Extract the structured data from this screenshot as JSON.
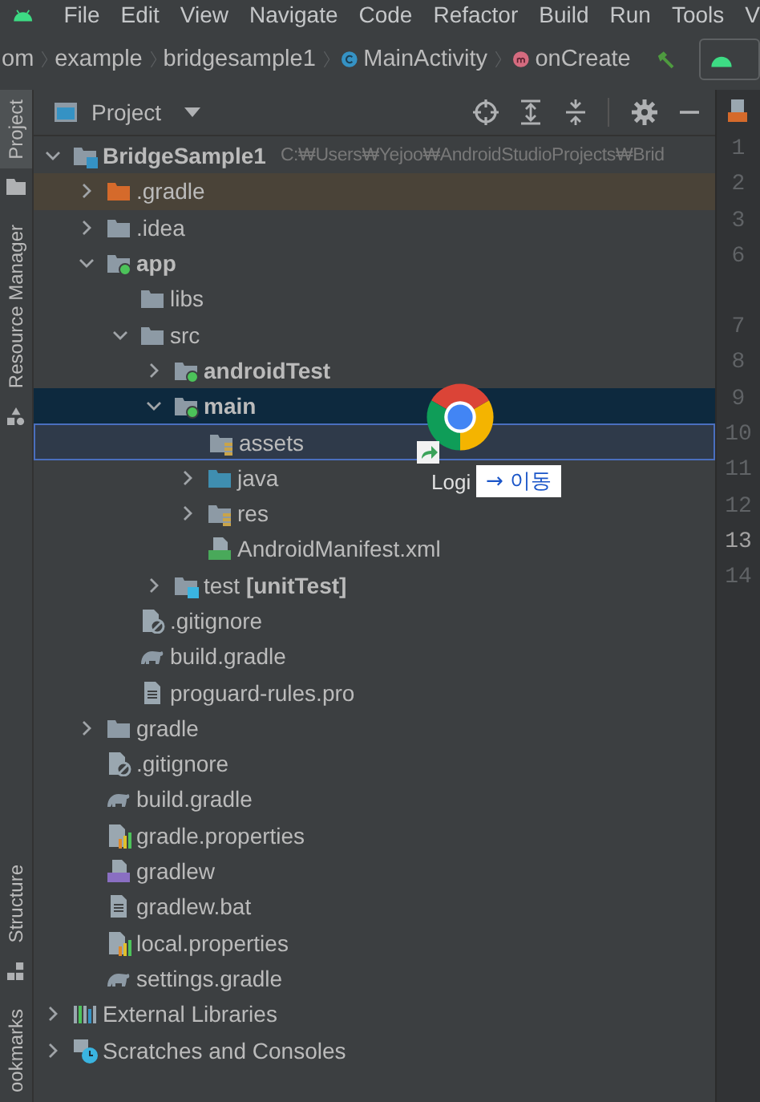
{
  "menu_bar": {
    "items": [
      "File",
      "Edit",
      "View",
      "Navigate",
      "Code",
      "Refactor",
      "Build",
      "Run",
      "Tools",
      "V"
    ]
  },
  "breadcrumbs": [
    {
      "label": "om",
      "kind": "package"
    },
    {
      "label": "example",
      "kind": "package"
    },
    {
      "label": "bridgesample1",
      "kind": "package"
    },
    {
      "label": "MainActivity",
      "kind": "class"
    },
    {
      "label": "onCreate",
      "kind": "method"
    }
  ],
  "side_tabs": {
    "top": [
      {
        "label": "Project",
        "selected": true
      },
      {
        "label": "Resource Manager",
        "selected": false
      }
    ],
    "bottom": [
      {
        "label": "Structure",
        "selected": false
      },
      {
        "label": "ookmarks",
        "selected": false
      }
    ]
  },
  "project_panel": {
    "title": "Project",
    "tree": [
      {
        "name": "BridgeSample1",
        "kind": "root",
        "hint": "C:₩Users₩Yejoo₩AndroidStudioProjects₩Brid",
        "expanded": true,
        "selected": false,
        "drop_target": false,
        "children": [
          {
            "name": ".gradle",
            "kind": "excluded-folder",
            "expanded": false,
            "selected": false,
            "drop_target": false
          },
          {
            "name": ".idea",
            "kind": "folder",
            "expanded": false,
            "selected": false,
            "drop_target": false
          },
          {
            "name": "app",
            "kind": "module",
            "expanded": true,
            "selected": false,
            "drop_target": false,
            "children": [
              {
                "name": "libs",
                "kind": "folder",
                "selected": false,
                "drop_target": false
              },
              {
                "name": "src",
                "kind": "folder",
                "expanded": true,
                "selected": false,
                "drop_target": false,
                "children": [
                  {
                    "name": "androidTest",
                    "kind": "module",
                    "expanded": false,
                    "selected": false,
                    "drop_target": false
                  },
                  {
                    "name": "main",
                    "kind": "module",
                    "expanded": true,
                    "selected": true,
                    "drop_target": false,
                    "children": [
                      {
                        "name": "assets",
                        "kind": "resource-folder",
                        "selected": false,
                        "drop_target": true
                      },
                      {
                        "name": "java",
                        "kind": "source-folder",
                        "expanded": false,
                        "selected": false,
                        "drop_target": false
                      },
                      {
                        "name": "res",
                        "kind": "resource-folder",
                        "expanded": false,
                        "selected": false,
                        "drop_target": false
                      },
                      {
                        "name": "AndroidManifest.xml",
                        "kind": "manifest",
                        "selected": false,
                        "drop_target": false
                      }
                    ]
                  },
                  {
                    "name": "test **[unitTest]**",
                    "kind": "test-folder",
                    "expanded": false,
                    "selected": false,
                    "drop_target": false
                  }
                ]
              },
              {
                "name": ".gitignore",
                "kind": "ignore-file",
                "selected": false,
                "drop_target": false
              },
              {
                "name": "build.gradle",
                "kind": "gradle",
                "selected": false,
                "drop_target": false
              },
              {
                "name": "proguard-rules.pro",
                "kind": "text-file",
                "selected": false,
                "drop_target": false
              }
            ]
          },
          {
            "name": "gradle",
            "kind": "folder",
            "expanded": false,
            "selected": false,
            "drop_target": false
          },
          {
            "name": ".gitignore",
            "kind": "ignore-file",
            "selected": false,
            "drop_target": false
          },
          {
            "name": "build.gradle",
            "kind": "gradle",
            "selected": false,
            "drop_target": false
          },
          {
            "name": "gradle.properties",
            "kind": "properties",
            "selected": false,
            "drop_target": false
          },
          {
            "name": "gradlew",
            "kind": "script",
            "selected": false,
            "drop_target": false
          },
          {
            "name": "gradlew.bat",
            "kind": "text-file",
            "selected": false,
            "drop_target": false
          },
          {
            "name": "local.properties",
            "kind": "properties",
            "selected": false,
            "drop_target": false
          },
          {
            "name": "settings.gradle",
            "kind": "gradle",
            "selected": false,
            "drop_target": false
          }
        ]
      },
      {
        "name": "External Libraries",
        "kind": "libraries",
        "expanded": false,
        "selected": false,
        "drop_target": false
      },
      {
        "name": "Scratches and Consoles",
        "kind": "scratches",
        "expanded": false,
        "selected": false,
        "drop_target": false
      }
    ]
  },
  "drag_overlay": {
    "label": "Logi",
    "tooltip": "→ 이동"
  },
  "gutter": {
    "lines": [
      {
        "number": "1",
        "current": false
      },
      {
        "number": "2",
        "current": false
      },
      {
        "number": "3",
        "current": false
      },
      {
        "number": "6",
        "current": false
      },
      {
        "number": "7",
        "current": false
      },
      {
        "number": "8",
        "current": false
      },
      {
        "number": "9",
        "current": false
      },
      {
        "number": "10",
        "current": false
      },
      {
        "number": "11",
        "current": false
      },
      {
        "number": "12",
        "current": false
      },
      {
        "number": "13",
        "current": true
      },
      {
        "number": "14",
        "current": false
      }
    ]
  }
}
